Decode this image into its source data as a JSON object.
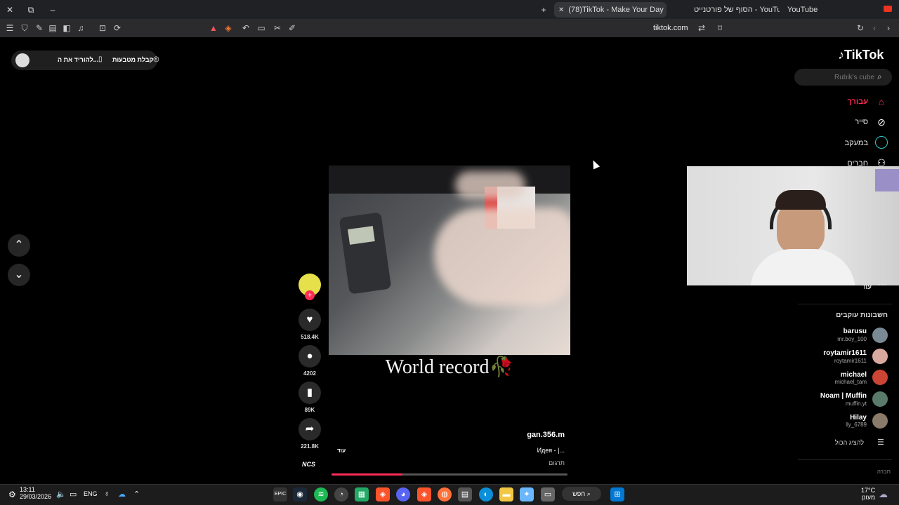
{
  "browser": {
    "tabs": [
      {
        "title": "(78)TikTok - Make Your Day",
        "active": true
      },
      {
        "title": "הסוף של פורטנייט - YouTube",
        "active": false
      },
      {
        "title": "YouTube",
        "active": false
      }
    ],
    "address": "tiktok.com",
    "new_tab_symbol": "+"
  },
  "tiktok": {
    "logo_text": "TikTok",
    "search_placeholder": "Rubik's cube",
    "top_pill": {
      "coins_label": "קבלת מטבעות",
      "download_label": "להוריד את ה..."
    },
    "nav": [
      {
        "label": "עבורך",
        "icon": "home-icon",
        "active": true
      },
      {
        "label": "סייר",
        "icon": "compass-icon",
        "active": false
      },
      {
        "label": "במעקב",
        "icon": "following-icon",
        "active": false
      },
      {
        "label": "חברים",
        "icon": "friends-icon",
        "active": false
      }
    ],
    "more_label": "עוד",
    "following_heading": "חשבונות עוקבים",
    "following": [
      {
        "name": "barusu",
        "handle": "mr.boy_100"
      },
      {
        "name": "roytamir1611",
        "handle": "roytamir1611"
      },
      {
        "name": "michael",
        "handle": "michael_tam"
      },
      {
        "name": "Noam | Muffin",
        "handle": "muffin.yt"
      },
      {
        "name": "Hilay",
        "handle": "lly_6789"
      }
    ],
    "show_all_label": "להציג הכול",
    "footer_label": "חברה",
    "video": {
      "overlay_text": "World record🥀",
      "author": "gan.356.m",
      "description": "Идея - |...",
      "more_label": "עוד",
      "translate_label": "תרגום",
      "progress": 0.3
    },
    "actions": {
      "likes": "518.4K",
      "comments": "4202",
      "saves": "89K",
      "shares": "221.8K"
    },
    "music_badge": "NCS"
  },
  "taskbar": {
    "time": "13:11",
    "date": "29/03/2026",
    "lang": "ENG",
    "search_label": "חפש",
    "weather_temp": "17°C",
    "weather_desc": "מעונן"
  },
  "colors": {
    "accent": "#fe2c55",
    "page_bg": "#000000"
  }
}
